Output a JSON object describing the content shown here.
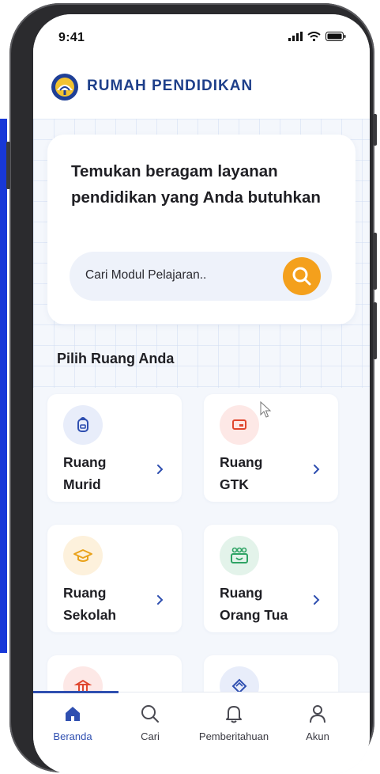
{
  "status_bar": {
    "time": "9:41"
  },
  "header": {
    "brand": "RUMAH PENDIDIKAN"
  },
  "hero": {
    "title": "Temukan beragam layanan pendidikan yang Anda butuhkan",
    "search_placeholder": "Cari Modul Pelajaran.."
  },
  "section": {
    "title": "Pilih Ruang Anda"
  },
  "rooms": [
    {
      "line1": "Ruang",
      "line2": "Murid",
      "icon": "backpack-icon",
      "icon_bg": "#e8edfa",
      "icon_color": "#2f4fb0"
    },
    {
      "line1": "Ruang",
      "line2": "GTK",
      "icon": "whiteboard-icon",
      "icon_bg": "#fde8e6",
      "icon_color": "#e0472f"
    },
    {
      "line1": "Ruang",
      "line2": "Sekolah",
      "icon": "graduation-cap-icon",
      "icon_bg": "#fdf1dc",
      "icon_color": "#e9a21b"
    },
    {
      "line1": "Ruang",
      "line2": "Orang Tua",
      "icon": "family-icon",
      "icon_bg": "#e3f3ea",
      "icon_color": "#2ea364"
    }
  ],
  "bottom_nav": [
    {
      "label": "Beranda",
      "icon": "home-icon",
      "active": true
    },
    {
      "label": "Cari",
      "icon": "search-icon",
      "active": false
    },
    {
      "label": "Pemberitahuan",
      "icon": "bell-icon",
      "active": false
    },
    {
      "label": "Akun",
      "icon": "user-icon",
      "active": false
    }
  ],
  "colors": {
    "accent": "#2f4fb0",
    "search_button": "#f4a01c",
    "brand": "#1e3f8a"
  }
}
